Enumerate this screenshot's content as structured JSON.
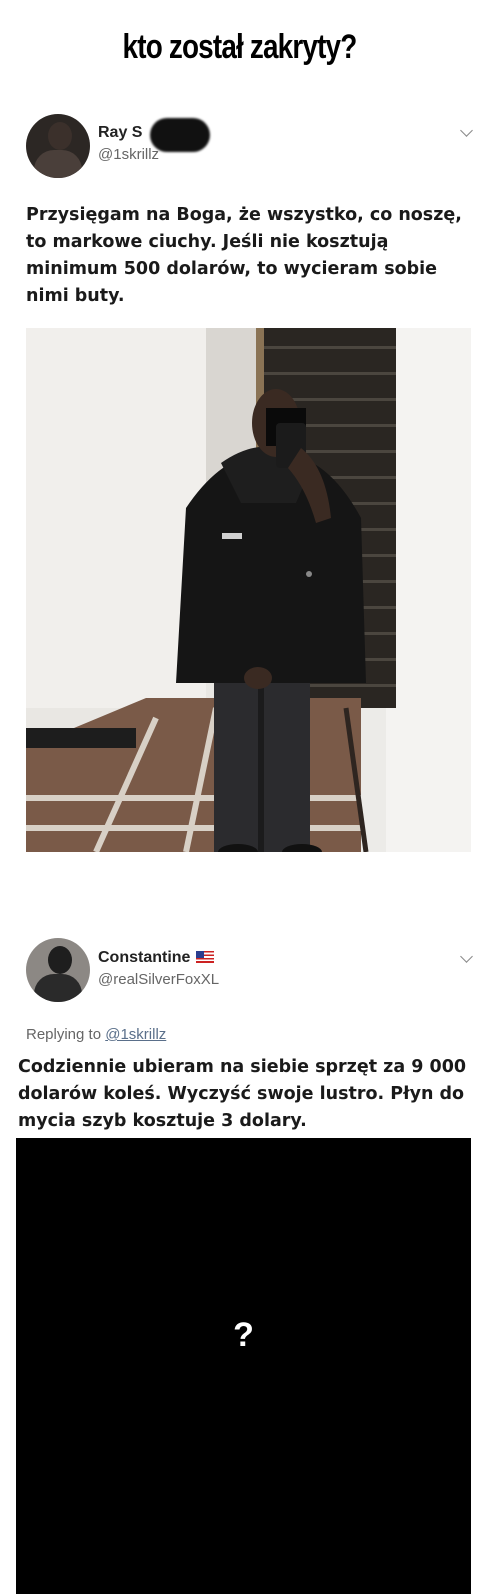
{
  "meme": {
    "title": "kto został zakryty?",
    "hidden_answer": "?"
  },
  "tweet1": {
    "display_name": "Ray S",
    "handle": "@1skrillz",
    "text_lines": [
      "Przysięgam na Boga, że wszystko, co noszę,",
      "to markowe ciuchy. Jeśli nie kosztują",
      "minimum 500 dolarów, to wycieram sobie",
      "nimi buty."
    ]
  },
  "tweet2": {
    "display_name": "Constantine",
    "handle": "@realSilverFoxXL",
    "replying_prefix": "Replying to",
    "replying_to": "@1skrillz",
    "text_lines": [
      "Codziennie ubieram na siebie sprzęt za 9 000",
      "dolarów koleś. Wyczyść swoje lustro. Płyn do",
      "mycia szyb kosztuje 3 dolary."
    ]
  }
}
